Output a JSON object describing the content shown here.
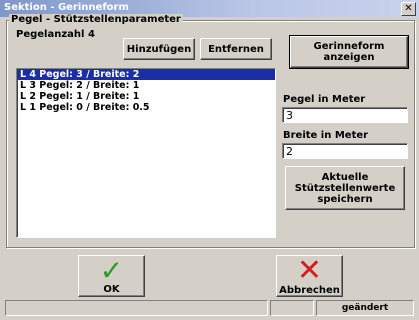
{
  "window": {
    "title": "Sektion - Gerinneform",
    "close_glyph": "✕"
  },
  "group": {
    "legend": "Pegel - Stützstellenparameter"
  },
  "pegel": {
    "count_label": "Pegelanzahl 4"
  },
  "buttons": {
    "add": "Hinzufügen",
    "remove": "Entfernen",
    "show_shape": "Gerinneform anzeigen",
    "save": "Aktuelle Stützstellenwerte speichern",
    "ok": "OK",
    "cancel": "Abbrechen"
  },
  "list": {
    "items": [
      "L 4  Pegel: 3 / Breite: 2",
      "L 3  Pegel: 2 / Breite: 1",
      "L 2  Pegel: 1 / Breite: 1",
      "L 1  Pegel: 0 / Breite: 0.5"
    ],
    "selected_index": 0
  },
  "fields": {
    "pegel_label": "Pegel in Meter",
    "pegel_value": "3",
    "breite_label": "Breite in Meter",
    "breite_value": "2"
  },
  "icons": {
    "ok": "checkmark-icon",
    "cancel": "x-icon",
    "close": "close-icon"
  },
  "status": {
    "right": "geändert"
  },
  "colors": {
    "selection": "#1c2ea7",
    "ok_green": "#2c9a2c",
    "cancel_red": "#d21f1f"
  }
}
